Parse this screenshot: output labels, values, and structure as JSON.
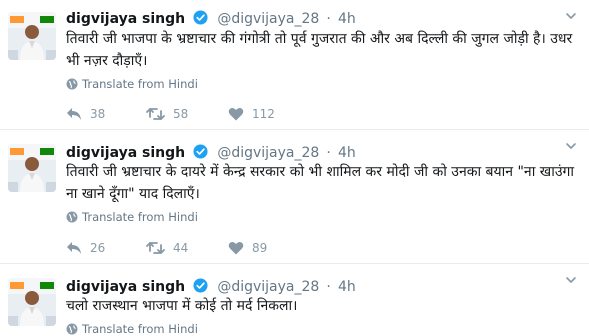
{
  "tweets": [
    {
      "name": "digvijaya singh",
      "handle": "@digvijaya_28",
      "time": "4h",
      "text": "तिवारी जी भाजपा के भ्रष्टाचार की गंगोत्री तो पूर्व गुजरात की और अब दिल्ली की जुगल जोड़ी है। उधर भी नज़र दौड़ाएँ।",
      "translate": "Translate from Hindi",
      "replies": "38",
      "retweets": "58",
      "likes": "112"
    },
    {
      "name": "digvijaya singh",
      "handle": "@digvijaya_28",
      "time": "4h",
      "text": "तिवारी जी भ्रष्टाचार के दायरे में केन्द्र सरकार को भी शामिल कर मोदी जी को उनका बयान \"ना खाउंगा ना खाने दूँगा\" याद दिलाएँ।",
      "translate": "Translate from Hindi",
      "replies": "26",
      "retweets": "44",
      "likes": "89"
    },
    {
      "name": "digvijaya singh",
      "handle": "@digvijaya_28",
      "time": "4h",
      "text": "चलो राजस्थान भाजपा में कोई तो मर्द निकला।",
      "translate": "Translate from Hindi"
    }
  ],
  "icons": {
    "verified": "verified-badge-icon",
    "more": "chevron-down-icon",
    "translate": "globe-icon",
    "reply": "reply-icon",
    "retweet": "retweet-icon",
    "like": "heart-icon"
  },
  "colors": {
    "name": "#14171a",
    "meta": "#657786",
    "action": "#8899a6",
    "verified": "#1da1f2",
    "divider": "#e6ecf0"
  }
}
